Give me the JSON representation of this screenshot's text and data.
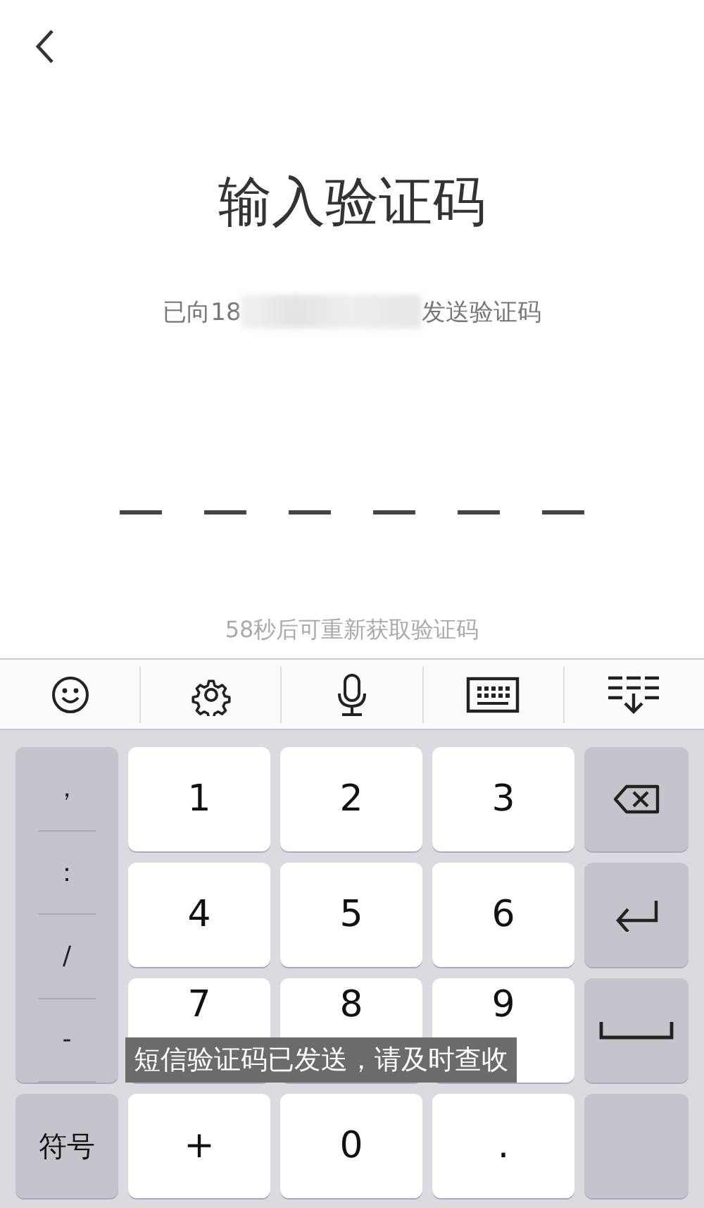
{
  "header": {
    "title": "输入验证码"
  },
  "sent_notice": {
    "prefix": "已向18",
    "suffix": "发送验证码"
  },
  "code_slots": [
    {
      "filled": false
    },
    {
      "filled": false
    },
    {
      "filled": false
    },
    {
      "filled": false
    },
    {
      "filled": false
    },
    {
      "filled": false
    }
  ],
  "resend": "58秒后可重新获取验证码",
  "keyboard": {
    "toolbar": [
      {
        "kind": "emoji"
      },
      {
        "kind": "settings"
      },
      {
        "kind": "microphone"
      },
      {
        "kind": "keyboard"
      },
      {
        "kind": "collapse"
      }
    ],
    "symbols": [
      "，",
      "：",
      "/",
      "-"
    ],
    "symbol_key": "符号",
    "digits": [
      [
        "1",
        "2",
        "3"
      ],
      [
        "4",
        "5",
        "6"
      ],
      [
        "7",
        "8",
        "9"
      ],
      [
        "+",
        "0",
        "."
      ]
    ],
    "side_keys": [
      {
        "kind": "backspace"
      },
      {
        "kind": "enter"
      },
      {
        "kind": "space"
      },
      {
        "kind": "blank"
      }
    ]
  },
  "toast": "短信验证码已发送，请及时查收"
}
